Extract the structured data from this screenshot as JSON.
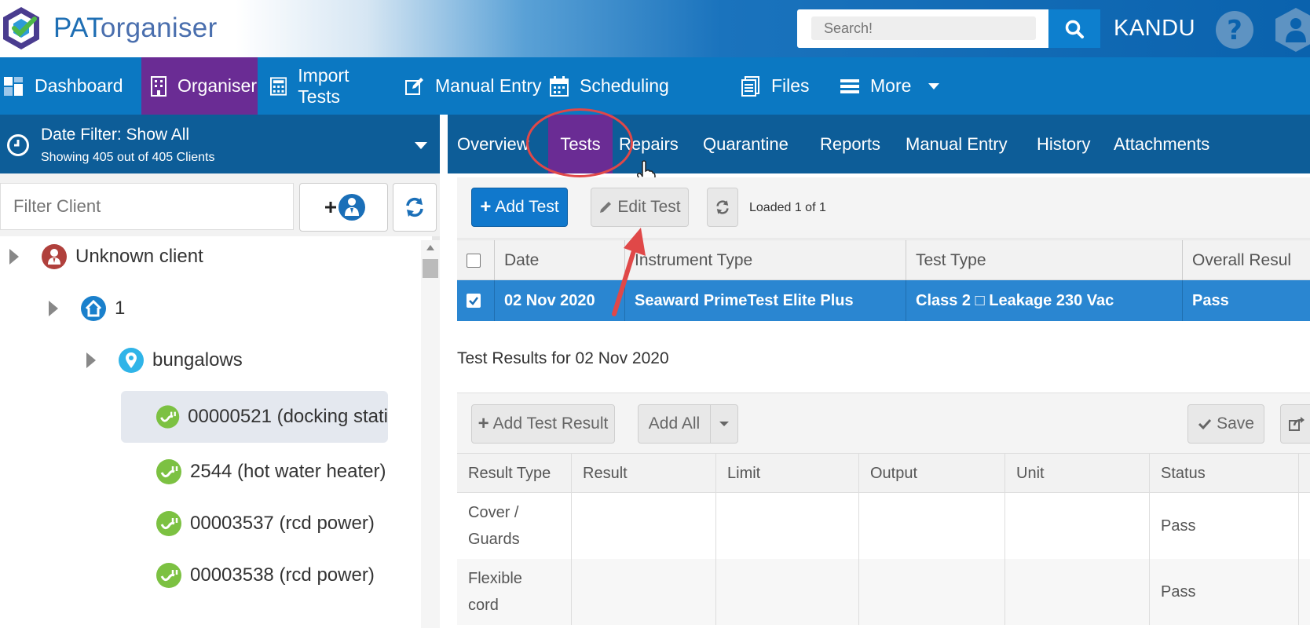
{
  "header": {
    "logo_main": "PAT",
    "logo_suffix": "organiser",
    "search_placeholder": "Search!",
    "user_name": "KANDU"
  },
  "main_nav": [
    {
      "label": "Dashboard",
      "icon": "dashboard-icon"
    },
    {
      "label": "Organiser",
      "icon": "building-icon",
      "active": true
    },
    {
      "label": "Import Tests",
      "icon": "calculator-icon"
    },
    {
      "label": "Manual Entry",
      "icon": "edit-icon"
    },
    {
      "label": "Scheduling",
      "icon": "calendar-icon"
    },
    {
      "label": "Files",
      "icon": "files-icon"
    },
    {
      "label": "More",
      "icon": "list-icon"
    }
  ],
  "date_filter": {
    "label": "Date Filter:  Show All",
    "summary": "Showing 405 out of 405 Clients"
  },
  "client_filter": {
    "placeholder": "Filter Client"
  },
  "tree": [
    {
      "label": "Unknown client",
      "icon": "client-icon",
      "level": 0
    },
    {
      "label": "1",
      "icon": "home-icon",
      "level": 1
    },
    {
      "label": "bungalows",
      "icon": "location-pin-icon",
      "level": 2
    },
    {
      "label": "00000521 (docking stati",
      "icon": "plug-icon",
      "level": 3,
      "selected": true
    },
    {
      "label": "2544 (hot water heater)",
      "icon": "plug-icon",
      "level": 3
    },
    {
      "label": "00003537 (rcd power)",
      "icon": "plug-icon",
      "level": 3
    },
    {
      "label": "00003538 (rcd power)",
      "icon": "plug-icon",
      "level": 3
    }
  ],
  "sub_tabs": [
    "Overview",
    "Tests",
    "Repairs",
    "Quarantine",
    "Reports",
    "Manual Entry",
    "History",
    "Attachments"
  ],
  "tests_toolbar": {
    "add_test": "Add Test",
    "edit_test": "Edit Test",
    "loaded": "Loaded 1 of 1"
  },
  "tests_table": {
    "headers": [
      "Date",
      "Instrument Type",
      "Test Type",
      "Overall Resul"
    ],
    "rows": [
      [
        "02 Nov 2020",
        "Seaward PrimeTest Elite Plus",
        "Class 2 □ Leakage 230 Vac",
        "Pass"
      ]
    ]
  },
  "results_title": "Test Results for 02 Nov 2020",
  "results_toolbar": {
    "add_result": "Add Test Result",
    "add_all": "Add All",
    "save": "Save"
  },
  "results_table": {
    "headers": [
      "Result Type",
      "Result",
      "Limit",
      "Output",
      "Unit",
      "Status"
    ],
    "rows": [
      [
        "Cover /\nGuards",
        "",
        "",
        "",
        "",
        "Pass"
      ],
      [
        "Flexible\ncord",
        "",
        "",
        "",
        "",
        "Pass"
      ]
    ]
  },
  "colors": {
    "nav_blue": "#0b78c2",
    "dark_blue": "#0d5d98",
    "active_purple": "#6a2c94",
    "primary_button": "#1078cc",
    "selected_row": "#2a86d1",
    "annotation_red": "#e04848"
  }
}
